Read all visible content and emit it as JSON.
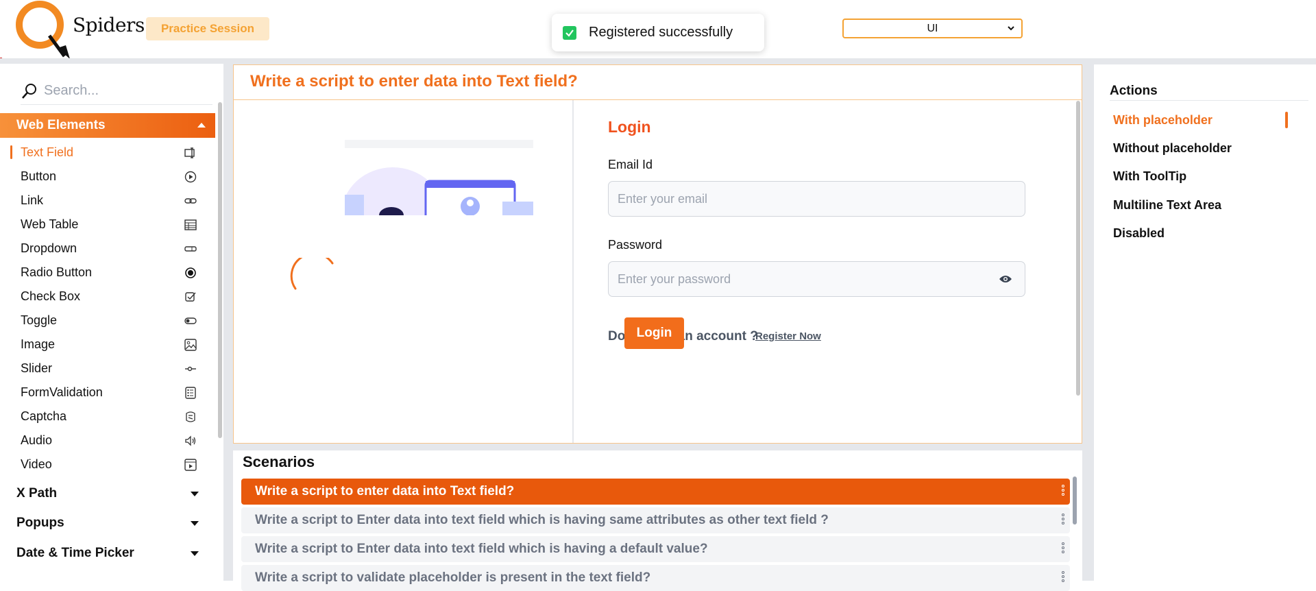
{
  "header": {
    "logo_text": "Spiders",
    "practice_label": "Practice Session",
    "toast_message": "Registered successfully",
    "mode_select_value": "UI"
  },
  "sidebar": {
    "search_placeholder": "Search...",
    "active_group": "Web Elements",
    "items": [
      {
        "label": "Text Field",
        "icon": "text-field-icon",
        "active": true
      },
      {
        "label": "Button",
        "icon": "play-circle-icon"
      },
      {
        "label": "Link",
        "icon": "link-icon"
      },
      {
        "label": "Web Table",
        "icon": "table-icon"
      },
      {
        "label": "Dropdown",
        "icon": "dropdown-icon"
      },
      {
        "label": "Radio Button",
        "icon": "radio-icon"
      },
      {
        "label": "Check Box",
        "icon": "checkbox-icon"
      },
      {
        "label": "Toggle",
        "icon": "toggle-icon"
      },
      {
        "label": "Image",
        "icon": "image-icon"
      },
      {
        "label": "Slider",
        "icon": "slider-icon"
      },
      {
        "label": "FormValidation",
        "icon": "form-list-icon"
      },
      {
        "label": "Captcha",
        "icon": "captcha-icon"
      },
      {
        "label": "Audio",
        "icon": "speaker-icon"
      },
      {
        "label": "Video",
        "icon": "video-icon"
      }
    ],
    "groups": [
      "X Path",
      "Popups",
      "Date & Time Picker"
    ]
  },
  "main": {
    "title": "Write a script to enter data into Text field?",
    "login": {
      "heading": "Login",
      "email_label": "Email Id",
      "email_placeholder": "Enter your email",
      "password_label": "Password",
      "password_placeholder": "Enter your password",
      "no_account_text": "Don't have an account ?",
      "register_link": "Register Now",
      "login_button": "Login"
    }
  },
  "scenarios": {
    "title": "Scenarios",
    "items": [
      "Write a script to enter data into Text field?",
      "Write a script to Enter data into text field which is having same attributes as other text field ?",
      "Write a script to Enter data into text field which is having a default value?",
      "Write a script to validate placeholder is present in the text field?"
    ]
  },
  "actions": {
    "title": "Actions",
    "items": [
      "With placeholder",
      "Without placeholder",
      "With ToolTip",
      "Multiline Text Area",
      "Disabled"
    ]
  },
  "colors": {
    "accent": "#f0701e",
    "accent_dark": "#e8590c",
    "success": "#22c55e",
    "badge_bg": "#fde8c8"
  }
}
